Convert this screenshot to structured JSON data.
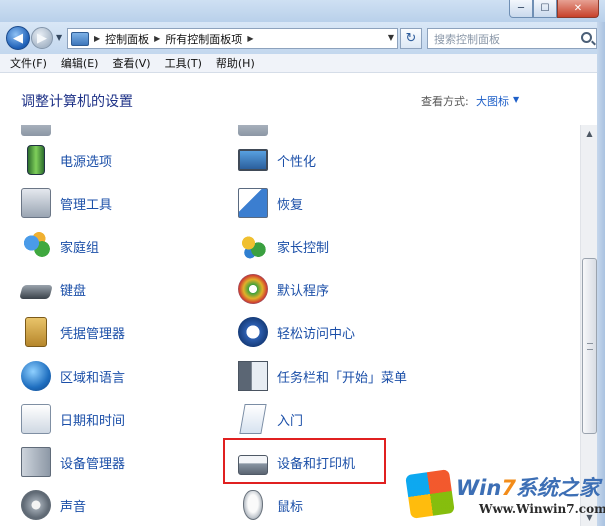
{
  "window": {
    "min_glyph": "─",
    "max_glyph": "☐",
    "close_glyph": "✕"
  },
  "nav": {
    "back_glyph": "◀",
    "forward_glyph": "▶",
    "breadcrumb": [
      "控制面板",
      "所有控制面板项"
    ],
    "search_placeholder": "搜索控制面板",
    "refresh_glyph": "↻"
  },
  "menu": [
    "文件(F)",
    "编辑(E)",
    "查看(V)",
    "工具(T)",
    "帮助(H)"
  ],
  "header": {
    "title": "调整计算机的设置",
    "view_label": "查看方式:",
    "view_value": "大图标"
  },
  "items": {
    "left": [
      {
        "label": "电源选项",
        "icon": "power-options-icon"
      },
      {
        "label": "管理工具",
        "icon": "admin-tools-icon"
      },
      {
        "label": "家庭组",
        "icon": "homegroup-icon"
      },
      {
        "label": "键盘",
        "icon": "keyboard-icon"
      },
      {
        "label": "凭据管理器",
        "icon": "credential-manager-icon"
      },
      {
        "label": "区域和语言",
        "icon": "region-language-icon"
      },
      {
        "label": "日期和时间",
        "icon": "date-time-icon"
      },
      {
        "label": "设备管理器",
        "icon": "device-manager-icon"
      },
      {
        "label": "声音",
        "icon": "sound-icon"
      }
    ],
    "right": [
      {
        "label": "个性化",
        "icon": "personalization-icon"
      },
      {
        "label": "恢复",
        "icon": "recovery-icon"
      },
      {
        "label": "家长控制",
        "icon": "parental-controls-icon"
      },
      {
        "label": "默认程序",
        "icon": "default-programs-icon"
      },
      {
        "label": "轻松访问中心",
        "icon": "ease-of-access-icon"
      },
      {
        "label": "任务栏和「开始」菜单",
        "icon": "taskbar-start-menu-icon"
      },
      {
        "label": "入门",
        "icon": "getting-started-icon"
      },
      {
        "label": "设备和打印机",
        "icon": "devices-printers-icon"
      },
      {
        "label": "鼠标",
        "icon": "mouse-icon"
      }
    ]
  },
  "watermark": {
    "brand_prefix": "Win",
    "brand_seven": "7",
    "brand_suffix": "系统之家",
    "url": "Www.Winwin7.com"
  },
  "colors": {
    "link": "#1b4fa8",
    "title": "#1e3287",
    "highlight": "#e02020"
  }
}
